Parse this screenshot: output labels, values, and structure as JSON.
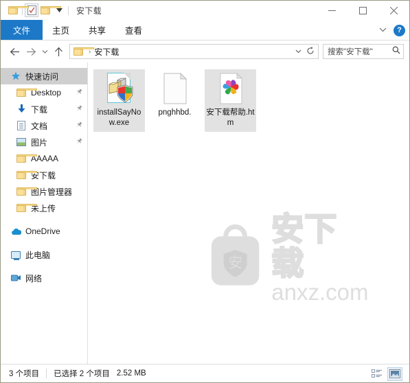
{
  "window": {
    "title": "安下载",
    "quick_access_toolbar": [
      {
        "name": "folder-icon",
        "label": "属性"
      },
      {
        "name": "properties-icon",
        "label": "属性"
      },
      {
        "name": "new-folder-icon",
        "label": "新建文件夹"
      },
      {
        "name": "chevron-down-icon",
        "label": "自定义快速访问工具栏"
      }
    ],
    "controls": {
      "minimize": "—",
      "maximize": "□",
      "close": "✕"
    }
  },
  "ribbon": {
    "tabs": [
      {
        "label": "文件",
        "active": true
      },
      {
        "label": "主页",
        "active": false
      },
      {
        "label": "共享",
        "active": false
      },
      {
        "label": "查看",
        "active": false
      }
    ],
    "expand_icon": "⌄",
    "help_label": "?"
  },
  "addressbar": {
    "back_icon": "←",
    "forward_icon": "→",
    "recent_icon": "⌄",
    "up_icon": "↑",
    "breadcrumb": [
      "安下载"
    ],
    "separator": "›",
    "dropdown_icon": "⌄",
    "refresh_icon": "↻",
    "search": {
      "placeholder": "搜索\"安下载\"",
      "icon": "⌕"
    }
  },
  "sidebar": {
    "items": [
      {
        "label": "快速访问",
        "icon": "star-icon",
        "selected": true,
        "pinned": false,
        "level": 0
      },
      {
        "label": "Desktop",
        "icon": "folder-icon",
        "selected": false,
        "pinned": true,
        "level": 1
      },
      {
        "label": "下载",
        "icon": "download-icon",
        "selected": false,
        "pinned": true,
        "level": 1
      },
      {
        "label": "文档",
        "icon": "document-icon",
        "selected": false,
        "pinned": true,
        "level": 1
      },
      {
        "label": "图片",
        "icon": "picture-icon",
        "selected": false,
        "pinned": true,
        "level": 1
      },
      {
        "label": "AAAAA",
        "icon": "folder-icon",
        "selected": false,
        "pinned": false,
        "level": 1
      },
      {
        "label": "安下载",
        "icon": "folder-icon",
        "selected": false,
        "pinned": false,
        "level": 1
      },
      {
        "label": "图片管理器",
        "icon": "folder-icon",
        "selected": false,
        "pinned": false,
        "level": 1
      },
      {
        "label": "未上传",
        "icon": "folder-icon",
        "selected": false,
        "pinned": false,
        "level": 1
      },
      {
        "label": "OneDrive",
        "icon": "cloud-icon",
        "selected": false,
        "pinned": false,
        "level": 0
      },
      {
        "label": "此电脑",
        "icon": "computer-icon",
        "selected": false,
        "pinned": false,
        "level": 0
      },
      {
        "label": "网络",
        "icon": "network-icon",
        "selected": false,
        "pinned": false,
        "level": 0
      }
    ]
  },
  "files": [
    {
      "name": "installSayNow.exe",
      "icon": "exe-installer-icon",
      "selected": true
    },
    {
      "name": "pnghhbd.",
      "icon": "blank-file-icon",
      "selected": false
    },
    {
      "name": "安下载帮助.htm",
      "icon": "html-pinwheel-icon",
      "selected": true
    }
  ],
  "watermark": {
    "logo_char": "安",
    "brand": "安下载",
    "site": "anxz.com"
  },
  "statusbar": {
    "item_count": "3 个项目",
    "selection": "已选择 2 个项目",
    "size": "2.52 MB",
    "views": [
      {
        "name": "details-view-button",
        "active": false
      },
      {
        "name": "large-icons-view-button",
        "active": true
      }
    ]
  },
  "colors": {
    "accent": "#1d79c8",
    "selection": "#e2e2e2",
    "nav_selection": "#cfcfcf",
    "folder": "#fbe09a",
    "watermark": "#dedede"
  }
}
